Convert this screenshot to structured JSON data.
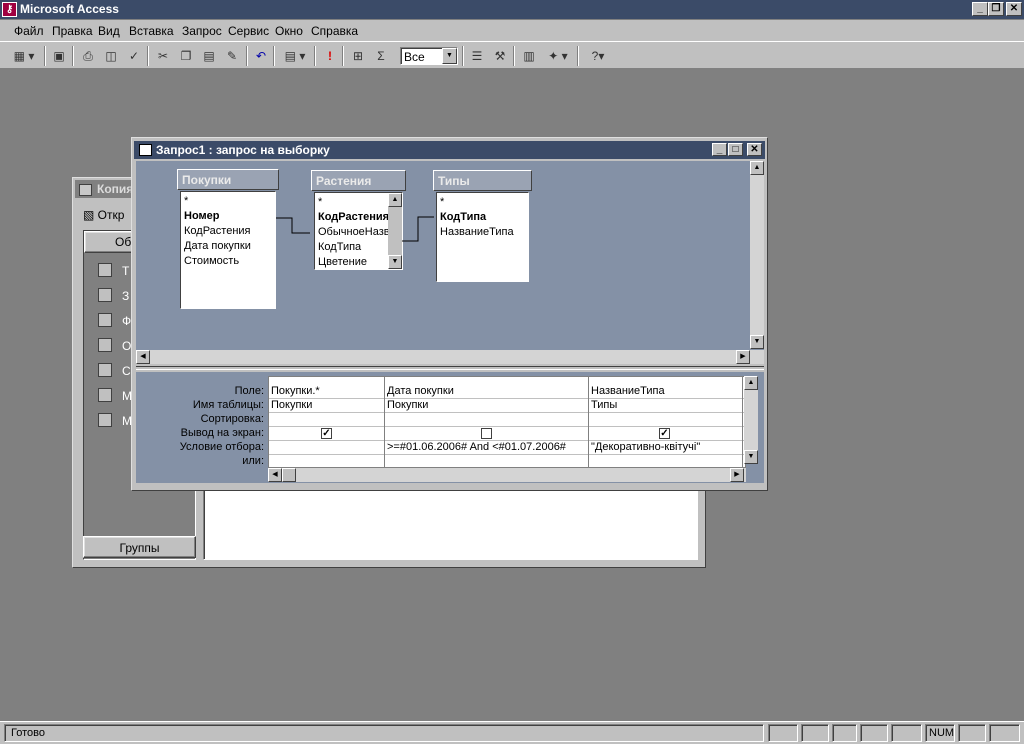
{
  "app": {
    "title": "Microsoft Access",
    "icon": "access-key-icon",
    "controls": {
      "minimize": "_",
      "restore": "❐",
      "close": "✕"
    }
  },
  "menu": [
    "Файл",
    "Правка",
    "Вид",
    "Вставка",
    "Запрос",
    "Сервис",
    "Окно",
    "Справка"
  ],
  "toolbar": {
    "combo_value": "Все",
    "icons": [
      "view-icon",
      "save-icon",
      "print-icon",
      "print-preview-icon",
      "spelling-icon",
      "cut-icon",
      "copy-icon",
      "paste-icon",
      "format-painter-icon",
      "undo-icon",
      "query-type-icon",
      "run-icon",
      "show-table-icon",
      "totals-icon",
      "properties-icon",
      "build-icon",
      "database-window-icon",
      "new-object-icon",
      "help-icon"
    ]
  },
  "db_window": {
    "title": "Копия",
    "open_label": "Откр",
    "objects_header": "Об",
    "items": [
      {
        "label": "Т",
        "icon": "tables-icon"
      },
      {
        "label": "З",
        "icon": "queries-icon"
      },
      {
        "label": "Ф",
        "icon": "forms-icon"
      },
      {
        "label": "О",
        "icon": "reports-icon"
      },
      {
        "label": "С",
        "icon": "pages-icon"
      },
      {
        "label": "М",
        "icon": "macros-icon"
      },
      {
        "label": "М",
        "icon": "modules-icon"
      }
    ],
    "groups_label": "Группы"
  },
  "query_window": {
    "title": "Запрос1 : запрос на выборку",
    "tables": [
      {
        "name": "Покупки",
        "fields": [
          {
            "text": "*",
            "bold": false
          },
          {
            "text": "Номер",
            "bold": true
          },
          {
            "text": "КодРастения",
            "bold": false
          },
          {
            "text": "Дата покупки",
            "bold": false
          },
          {
            "text": "Стоимость",
            "bold": false
          }
        ]
      },
      {
        "name": "Растения",
        "fields": [
          {
            "text": "*",
            "bold": false
          },
          {
            "text": "КодРастения",
            "bold": true
          },
          {
            "text": "ОбычноеНазв",
            "bold": false
          },
          {
            "text": "КодТипа",
            "bold": false
          },
          {
            "text": "Цветение",
            "bold": false
          }
        ]
      },
      {
        "name": "Типы",
        "fields": [
          {
            "text": "*",
            "bold": false
          },
          {
            "text": "КодТипа",
            "bold": true
          },
          {
            "text": "НазваниеТипа",
            "bold": false
          }
        ]
      }
    ],
    "grid": {
      "row_labels": [
        "Поле:",
        "Имя таблицы:",
        "Сортировка:",
        "Вывод на экран:",
        "Условие отбора:",
        "или:"
      ],
      "columns": [
        {
          "field": "Покупки.*",
          "table": "Покупки",
          "sort": "",
          "show": true,
          "criteria": "",
          "or": ""
        },
        {
          "field": "Дата покупки",
          "table": "Покупки",
          "sort": "",
          "show": false,
          "criteria": ">=#01.06.2006# And <#01.07.2006#",
          "or": ""
        },
        {
          "field": "НазваниеТипа",
          "table": "Типы",
          "sort": "",
          "show": true,
          "criteria": "\"Декоративно-квітучі\"",
          "or": ""
        }
      ]
    }
  },
  "status": {
    "text": "Готово",
    "num": "NUM"
  }
}
